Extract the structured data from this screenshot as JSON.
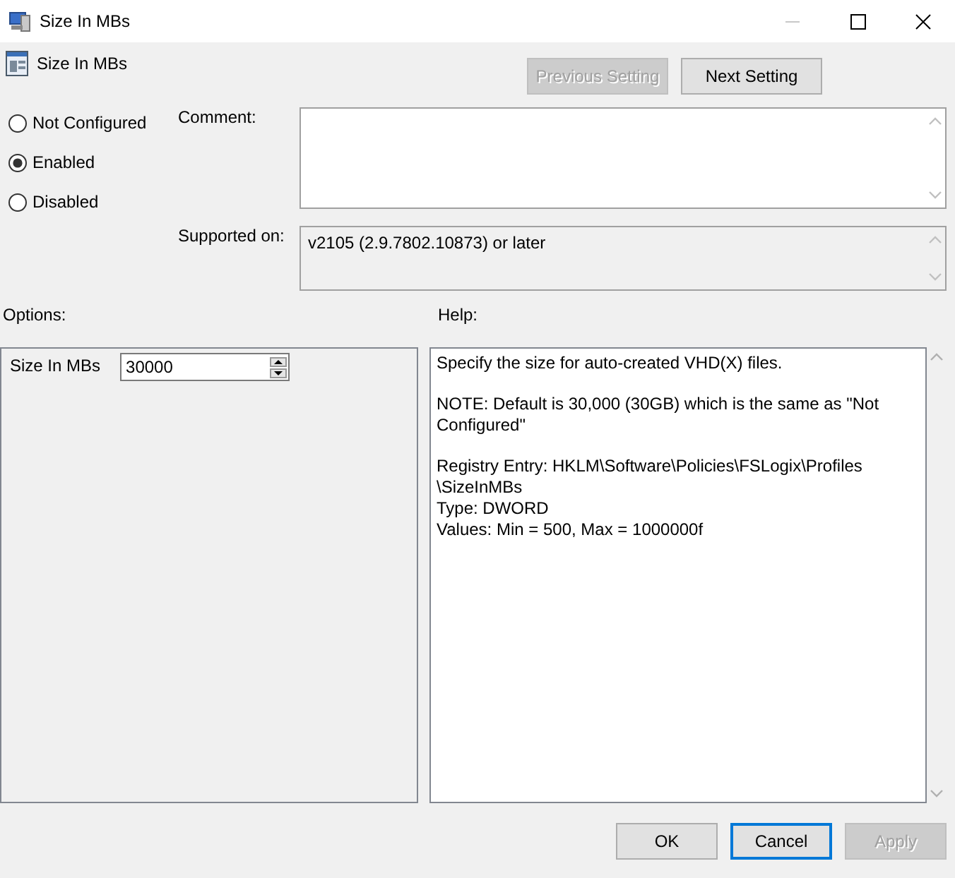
{
  "window": {
    "title": "Size In MBs",
    "controls": [
      {
        "kind": "minimize",
        "disabled": true
      },
      {
        "kind": "maximize",
        "disabled": false
      },
      {
        "kind": "close",
        "disabled": false
      }
    ]
  },
  "header": {
    "setting_name": "Size In MBs",
    "buttons": [
      {
        "label": "Previous Setting",
        "disabled": true
      },
      {
        "label": "Next Setting",
        "disabled": false
      }
    ]
  },
  "state_options": [
    {
      "label": "Not Configured",
      "selected": false
    },
    {
      "label": "Enabled",
      "selected": true
    },
    {
      "label": "Disabled",
      "selected": false
    }
  ],
  "comment": {
    "label": "Comment:"
  },
  "supported_on": {
    "label": "Supported on:",
    "value": "v2105 (2.9.7802.10873) or later"
  },
  "options": {
    "label": "Options:",
    "field_label": "Size In MBs",
    "value": "30000"
  },
  "help": {
    "label": "Help:",
    "paragraphs": [
      [
        "Specify the size for auto-created VHD(X) files."
      ],
      [
        "NOTE:  Default is 30,000 (30GB) which is the same as \"Not",
        "Configured\""
      ],
      [
        "Registry Entry:  HKLM\\Software\\Policies\\FSLogix\\Profiles",
        "\\SizeInMBs",
        "Type:  DWORD",
        "Values:  Min = 500, Max = 1000000f"
      ]
    ]
  },
  "footer_buttons": [
    {
      "label": "OK",
      "disabled": false,
      "focused": false
    },
    {
      "label": "Cancel",
      "disabled": false,
      "focused": true
    },
    {
      "label": "Apply",
      "disabled": true,
      "focused": false
    }
  ]
}
